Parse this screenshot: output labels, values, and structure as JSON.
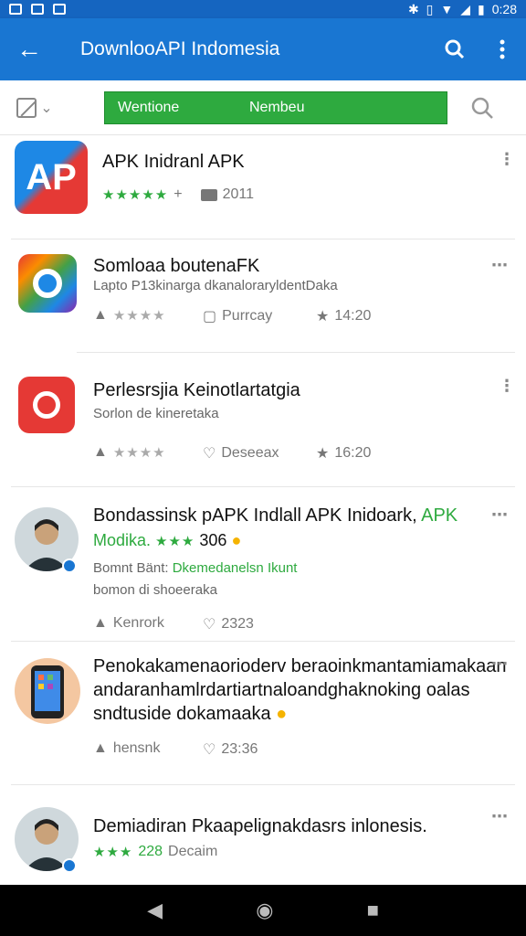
{
  "status": {
    "time": "0:28"
  },
  "appbar": {
    "title": "DownlooAPI Indomesia",
    "back_icon": "arrow-back-icon",
    "search_icon": "search-icon",
    "menu_icon": "more-vert-icon"
  },
  "toolbar": {
    "tab1": "Wentione",
    "tab2": "Nembeu"
  },
  "items": [
    {
      "title": "APK Inidranl APK",
      "stars": "★★★★★",
      "star_suffix": "+",
      "meta": "2011"
    },
    {
      "title": "Somloaa boutenaFK",
      "subtitle": "Lapto P13kinarga dkanaloraryldentDaka",
      "m1": "Purrcay",
      "m2": "14:20"
    },
    {
      "title": "Perlesrsjia Keinotlartatgia",
      "subtitle": "Sorlon de kineretaka",
      "m1": "Deseeax",
      "m2": "16:20"
    },
    {
      "title_a": "Bondassinsk pAPK Indlall APK Inidoark, ",
      "title_b": "APK",
      "line2_a": "Modika. ",
      "line2_stars": "★★★",
      "line2_b": "306 ",
      "line3_a": "Bomnt Bänt: ",
      "line3_b": "Dkemedanelsn Ikunt",
      "line4": "bomon di shoeeraka",
      "m1": "Kenrork",
      "m2": "2323"
    },
    {
      "line1": "Penokakamenaorioderv beraoinkmantamiamakaan",
      "line2": "andaranhamlrdartiartnaloandghaknoking oalas",
      "line3": "sndtuside dokamaaka",
      "m1": "hensnk",
      "m2": "23:36"
    },
    {
      "title": "Demiadiran Pkaapelignakdasrs inlonesis.",
      "stars": "★★★",
      "meta_g": "228",
      "meta": "Decaim"
    }
  ]
}
